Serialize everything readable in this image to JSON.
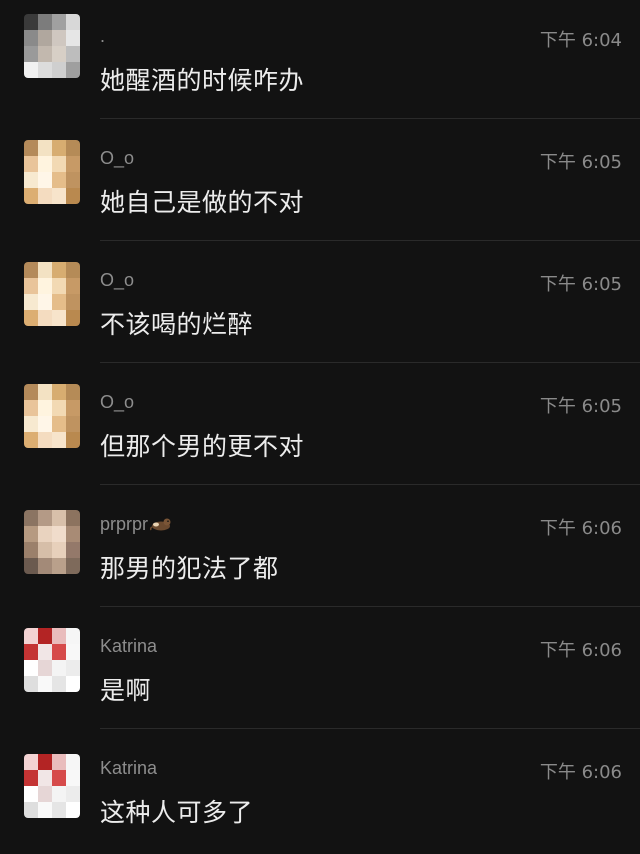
{
  "messages": [
    {
      "sender": ".",
      "time": "下午 6:04",
      "text": "她醒酒的时候咋办",
      "avatar_colors": [
        "#3a3a3a",
        "#7c7c7c",
        "#a0a0a0",
        "#d8d8d8",
        "#8a8a8a",
        "#b0a79e",
        "#cfc7c0",
        "#e6e6e6",
        "#9a9a9a",
        "#c2b8ae",
        "#d7cfc6",
        "#bdbdbd",
        "#f1f1f1",
        "#dcdcdc",
        "#cfcfcf",
        "#9f9f9f"
      ]
    },
    {
      "sender": "O_o",
      "time": "下午 6:05",
      "text": "她自己是做的不对",
      "avatar_colors": [
        "#b48a5a",
        "#f3e2c3",
        "#d7ad71",
        "#b58b57",
        "#e9c49a",
        "#fff4df",
        "#f2d9b3",
        "#c79a66",
        "#f7e9d0",
        "#fff6e8",
        "#e5bd8a",
        "#bf9360",
        "#dcae72",
        "#f4dcc0",
        "#f7e4cb",
        "#b9894f"
      ]
    },
    {
      "sender": "O_o",
      "time": "下午 6:05",
      "text": "不该喝的烂醉",
      "avatar_colors": [
        "#b48a5a",
        "#f3e2c3",
        "#d7ad71",
        "#b58b57",
        "#e9c49a",
        "#fff4df",
        "#f2d9b3",
        "#c79a66",
        "#f7e9d0",
        "#fff6e8",
        "#e5bd8a",
        "#bf9360",
        "#dcae72",
        "#f4dcc0",
        "#f7e4cb",
        "#b9894f"
      ]
    },
    {
      "sender": "O_o",
      "time": "下午 6:05",
      "text": "但那个男的更不对",
      "avatar_colors": [
        "#b48a5a",
        "#f3e2c3",
        "#d7ad71",
        "#b58b57",
        "#e9c49a",
        "#fff4df",
        "#f2d9b3",
        "#c79a66",
        "#f7e9d0",
        "#fff6e8",
        "#e5bd8a",
        "#bf9360",
        "#dcae72",
        "#f4dcc0",
        "#f7e4cb",
        "#b9894f"
      ]
    },
    {
      "sender": "prprpr",
      "time": "下午 6:06",
      "text": "那男的犯法了都",
      "emoji": "otter-emoji",
      "avatar_colors": [
        "#8b7462",
        "#b49a86",
        "#d8c0aa",
        "#8c735f",
        "#b69a81",
        "#e9d3bf",
        "#f0dccb",
        "#a88b75",
        "#9b806b",
        "#d6bea8",
        "#e7d0bb",
        "#94796a",
        "#6b5a4f",
        "#a38a78",
        "#b9a08b",
        "#7e6a5b"
      ]
    },
    {
      "sender": "Katrina",
      "time": "下午 6:06",
      "text": "是啊",
      "avatar_colors": [
        "#f3d3d3",
        "#b32424",
        "#e9bcbc",
        "#f6f6f6",
        "#c43434",
        "#f1e6e6",
        "#d64b4b",
        "#f8f8f8",
        "#ffffff",
        "#e6d6d6",
        "#f4f4f4",
        "#ececec",
        "#dedede",
        "#f9f9f9",
        "#e5e5e5",
        "#ffffff"
      ]
    },
    {
      "sender": "Katrina",
      "time": "下午 6:06",
      "text": "这种人可多了",
      "avatar_colors": [
        "#f3d3d3",
        "#b32424",
        "#e9bcbc",
        "#f6f6f6",
        "#c43434",
        "#f1e6e6",
        "#d64b4b",
        "#f8f8f8",
        "#ffffff",
        "#e6d6d6",
        "#f4f4f4",
        "#ececec",
        "#dedede",
        "#f9f9f9",
        "#e5e5e5",
        "#ffffff"
      ]
    }
  ]
}
